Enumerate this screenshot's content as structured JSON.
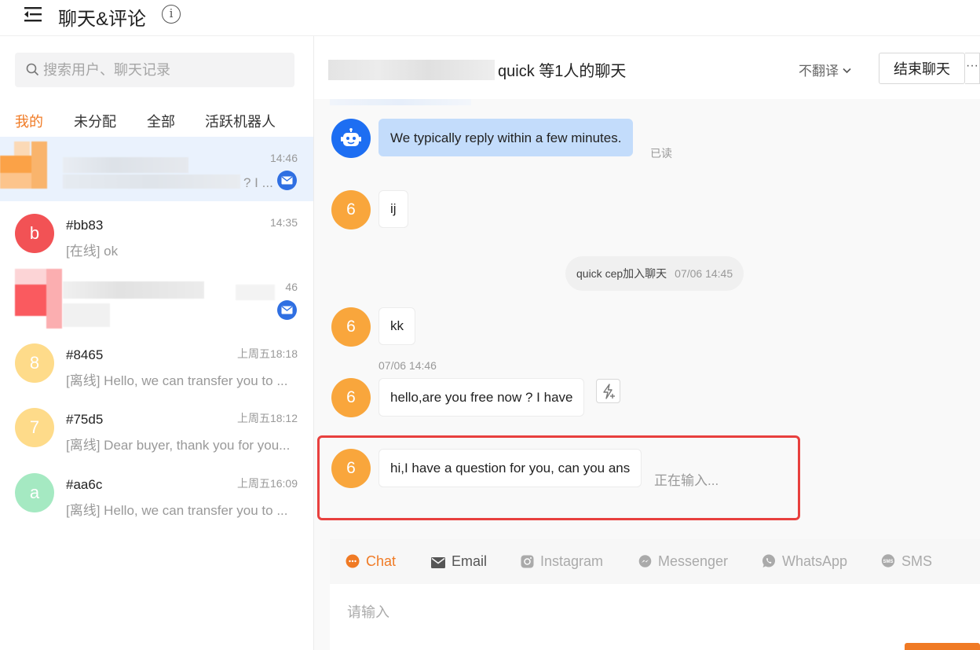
{
  "header": {
    "title": "聊天&评论",
    "info_symbol": "i"
  },
  "search": {
    "placeholder": "搜索用户、聊天记录"
  },
  "tabs": [
    {
      "label": "我的",
      "active": true
    },
    {
      "label": "未分配",
      "active": false
    },
    {
      "label": "全部",
      "active": false
    },
    {
      "label": "活跃机器人",
      "active": false
    }
  ],
  "conversations": [
    {
      "name": "",
      "time": "14:46",
      "preview": "? I ...",
      "avatar_letter": "",
      "blurred": true,
      "selected": true,
      "unread_mail": true
    },
    {
      "name": "#bb83",
      "time": "14:35",
      "preview": "[在线] ok",
      "avatar_letter": "b",
      "avatar_color": "#f25255",
      "blurred": false
    },
    {
      "name": "",
      "time": "46",
      "preview": "",
      "avatar_letter": "",
      "blurred": true,
      "unread_mail": true
    },
    {
      "name": "#8465",
      "time": "上周五18:18",
      "preview": "[离线] Hello, we can transfer you to ...",
      "avatar_letter": "8",
      "avatar_color": "#fedb8a"
    },
    {
      "name": "#75d5",
      "time": "上周五18:12",
      "preview": "[离线] Dear buyer, thank you for you...",
      "avatar_letter": "7",
      "avatar_color": "#fedb8a"
    },
    {
      "name": "#aa6c",
      "time": "上周五16:09",
      "preview": "[离线] Hello, we can transfer you to ...",
      "avatar_letter": "a",
      "avatar_color": "#a5e9c2"
    }
  ],
  "chat": {
    "title": "quick 等1人的聊天",
    "translate_label": "不翻译",
    "end_button": "结束聊天",
    "more_symbol": "···",
    "messages": [
      {
        "type": "bot",
        "text": "We typically reply within a few minutes.",
        "status": "已读"
      },
      {
        "type": "user",
        "avatar": "6",
        "text": "ij"
      },
      {
        "type": "system",
        "text": "quick cep加入聊天",
        "time": "07/06 14:45"
      },
      {
        "type": "user",
        "avatar": "6",
        "text": "kk"
      },
      {
        "type": "timestamp",
        "text": "07/06 14:46"
      },
      {
        "type": "user",
        "avatar": "6",
        "text": "hello,are you free now ? I have"
      },
      {
        "type": "user",
        "avatar": "6",
        "text": "hi,I have a question for you, can you ans",
        "typing": "正在输入..."
      }
    ]
  },
  "composer": {
    "channels": [
      {
        "label": "Chat",
        "icon": "chat-bubble-icon",
        "active": true
      },
      {
        "label": "Email",
        "icon": "envelope-icon",
        "active": false
      },
      {
        "label": "Instagram",
        "icon": "instagram-icon",
        "active": false
      },
      {
        "label": "Messenger",
        "icon": "messenger-icon",
        "active": false
      },
      {
        "label": "WhatsApp",
        "icon": "whatsapp-icon",
        "active": false
      },
      {
        "label": "SMS",
        "icon": "sms-icon",
        "active": false
      }
    ],
    "placeholder": "请输入"
  },
  "colors": {
    "accent": "#f07a24",
    "bot_blue": "#1d6ef2",
    "highlight": "#e8403e"
  }
}
